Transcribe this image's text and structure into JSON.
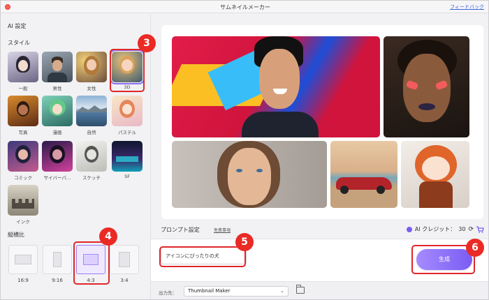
{
  "window": {
    "title": "サムネイルメーカー",
    "feedback_link": "フィードバック"
  },
  "sidebar": {
    "ai_settings_label": "AI 設定",
    "style_label": "スタイル",
    "styles": [
      {
        "label": "一般"
      },
      {
        "label": "男性"
      },
      {
        "label": "女性"
      },
      {
        "label": "3D"
      },
      {
        "label": "写真"
      },
      {
        "label": "漫画"
      },
      {
        "label": "自然"
      },
      {
        "label": "パステル"
      },
      {
        "label": "コミック"
      },
      {
        "label": "サイバーパ…"
      },
      {
        "label": "スケッチ"
      },
      {
        "label": "SF"
      },
      {
        "label": "インク"
      }
    ],
    "selected_style": "3D",
    "aspect_label": "縦横比",
    "ratios": [
      {
        "label": "16:9"
      },
      {
        "label": "9:16"
      },
      {
        "label": "4:3"
      },
      {
        "label": "3:4"
      }
    ],
    "selected_ratio": "4:3"
  },
  "main": {
    "prompt_title": "プロンプト設定",
    "disclaimer_link": "免責事項",
    "credit_label": "AI クレジット：",
    "credit_value": "30",
    "prompt_value": "アイコンにぴったりの犬",
    "generate_button": "生成",
    "output_label": "出力先：",
    "output_value": "Thumbnail Maker"
  },
  "callouts": [
    "3",
    "4",
    "5",
    "6"
  ],
  "colors": {
    "accent": "#7a5cf2",
    "callout": "#ea2a24",
    "link": "#3a62d8"
  },
  "icons": [
    "refresh-icon",
    "cart-icon",
    "folder-icon",
    "chevron-down-icon",
    "ai-credit-icon"
  ]
}
